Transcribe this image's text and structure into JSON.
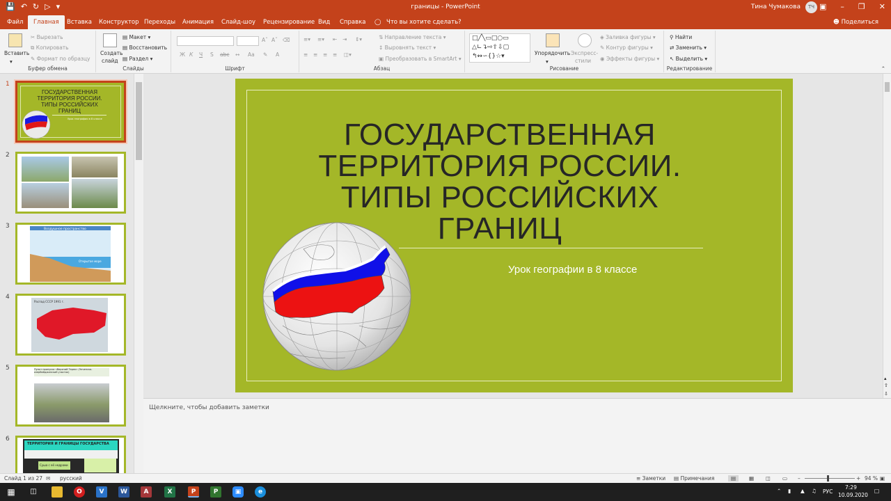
{
  "window": {
    "title": "границы - PowerPoint",
    "user_name": "Тина Чумакова",
    "user_initials": "ТЧ"
  },
  "menu": {
    "tabs": [
      "Файл",
      "Главная",
      "Вставка",
      "Конструктор",
      "Переходы",
      "Анимация",
      "Слайд-шоу",
      "Рецензирование",
      "Вид",
      "Справка"
    ],
    "tell_me": "Что вы хотите сделать?",
    "share": "Поделиться"
  },
  "ribbon": {
    "clipboard": {
      "label": "Буфер обмена",
      "paste": "Вставить",
      "cut": "Вырезать",
      "copy": "Копировать",
      "format_painter": "Формат по образцу"
    },
    "slides": {
      "label": "Слайды",
      "new_slide_1": "Создать",
      "new_slide_2": "слайд",
      "layout": "Макет",
      "reset": "Восстановить",
      "section": "Раздел"
    },
    "font": {
      "label": "Шрифт",
      "bold": "Ж",
      "italic": "К",
      "underline": "Ч",
      "shadow": "S",
      "strike": "abc",
      "font_color": "A"
    },
    "paragraph": {
      "label": "Абзац",
      "text_direction": "Направление текста",
      "align_text": "Выровнять текст",
      "smartart": "Преобразовать в SmartArt"
    },
    "drawing": {
      "label": "Рисование",
      "arrange": "Упорядочить",
      "quick_styles_1": "Экспресс-",
      "quick_styles_2": "стили",
      "shape_fill": "Заливка фигуры",
      "shape_outline": "Контур фигуры",
      "shape_effects": "Эффекты фигуры"
    },
    "editing": {
      "label": "Редактирование",
      "find": "Найти",
      "replace": "Заменить",
      "select": "Выделить"
    }
  },
  "thumbnails": [
    {
      "num": "1",
      "title": "ГОСУДАРСТВЕННАЯ ТЕРРИТОРИЯ РОССИИ. ТИПЫ РОССИЙСКИХ ГРАНИЦ",
      "subtitle": "Урок географии в 8 классе"
    },
    {
      "num": "2"
    },
    {
      "num": "3",
      "caption_1": "Воздушное пространство",
      "caption_2": "Открытое море"
    },
    {
      "num": "4",
      "caption": "Распад СССР 1991 г."
    },
    {
      "num": "5",
      "caption": "Пункт пропуска «Верхний Терек» (Чеченско-азербайджанский участок)"
    },
    {
      "num": "6",
      "title": "ТЕРРИТОРИЯ И ГРАНИЦЫ ГОСУДАРСТВА",
      "box": "Суша с её недрами"
    }
  ],
  "slide": {
    "title": "ГОСУДАРСТВЕННАЯ ТЕРРИТОРИЯ РОССИИ. ТИПЫ РОССИЙСКИХ ГРАНИЦ",
    "subtitle": "Урок географии в 8 классе"
  },
  "notes": {
    "placeholder": "Щелкните, чтобы добавить заметки"
  },
  "status": {
    "slide_counter": "Слайд 1 из 27",
    "language": "русский",
    "notes": "Заметки",
    "comments": "Примечания",
    "zoom": "94 %"
  },
  "taskbar": {
    "lang": "РУС",
    "time": "7:29",
    "date": "10.09.2020"
  },
  "colors": {
    "accent": "#c4421b",
    "slide_bg": "#a4b728",
    "taskbar": "#1f1f1f"
  }
}
